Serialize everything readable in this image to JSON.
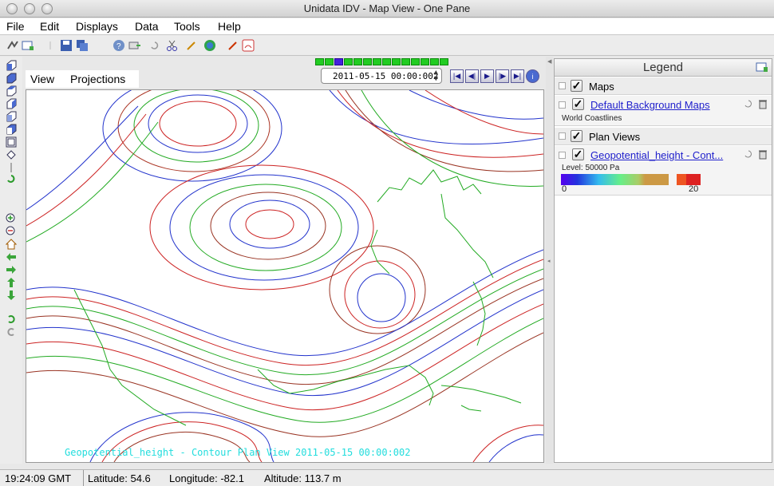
{
  "window": {
    "title": "Unidata IDV - Map View - One Pane"
  },
  "menu": [
    "File",
    "Edit",
    "Displays",
    "Data",
    "Tools",
    "Help"
  ],
  "view_menu": {
    "view": "View",
    "projections": "Projections"
  },
  "animation": {
    "time": "2011-05-15 00:00:002",
    "frame_count": 14,
    "current_frame": 3
  },
  "map": {
    "label": "Geopotential_height - Contour Plan View 2011-05-15 00:00:002"
  },
  "legend": {
    "title": "Legend",
    "groups": [
      {
        "name": "Maps"
      },
      {
        "name": "Plan Views"
      }
    ],
    "background_maps": {
      "name": "Default Background Maps",
      "detail": "World Coastlines"
    },
    "geopotential": {
      "name": "Geopotential_height - Cont...",
      "level": "Level: 50000 Pa",
      "range_min": "0",
      "range_max": "20"
    }
  },
  "status": {
    "time": "19:24:09 GMT",
    "latitude": "Latitude:  54.6",
    "longitude": "Longitude:  -82.1",
    "altitude": "Altitude:  113.7 m"
  },
  "colors": {
    "animation_on": "#22cc22",
    "animation_current": "#4422dd",
    "map_label": "#22dddd",
    "coastline": "#22aa22",
    "link": "#2020cc"
  }
}
